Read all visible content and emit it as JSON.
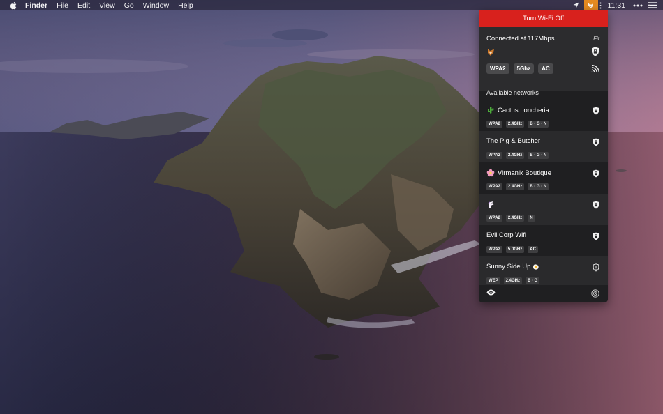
{
  "menubar": {
    "apple_icon": "apple-icon",
    "items": [
      "Finder",
      "File",
      "Edit",
      "View",
      "Go",
      "Window",
      "Help"
    ],
    "clock": "11:31",
    "status_icons": [
      "location-arrow-icon",
      "app-fox-icon",
      "wifi-icon",
      "list-icon"
    ]
  },
  "popover": {
    "toggle_label": "Turn Wi-Fi Off",
    "accent_color": "#d8211d",
    "connected": {
      "title": "Connected at 117Mbps",
      "fit_label": "Fit",
      "network_icon": "fox-icon",
      "chips": [
        "WPA2",
        "5Ghz",
        "AC"
      ]
    },
    "available_title": "Available networks",
    "networks": [
      {
        "name": "Cactus Loncheria",
        "icon": "cactus-icon",
        "secured": true,
        "tags": [
          "WPA2",
          "2.4GHz",
          "B · G · N"
        ]
      },
      {
        "name": "The Pig & Butcher",
        "icon": "",
        "secured": true,
        "tags": [
          "WPA2",
          "2.4GHz",
          "B · G · N"
        ]
      },
      {
        "name": "Virmanik Boutique",
        "icon": "flower-icon",
        "secured": true,
        "tags": [
          "WPA2",
          "2.4GHz",
          "B · G · N"
        ]
      },
      {
        "name": "",
        "icon": "unicorn-icon",
        "secured": true,
        "tags": [
          "WPA2",
          "2.4GHz",
          "N"
        ]
      },
      {
        "name": "Evil Corp Wifi",
        "icon": "",
        "secured": true,
        "tags": [
          "WPA2",
          "5.0GHz",
          "AC"
        ]
      },
      {
        "name": "Sunny Side Up",
        "icon_after": "egg-icon",
        "secured": false,
        "tags": [
          "WEP",
          "2.4GHz",
          "B · G"
        ]
      }
    ],
    "footer_icons": [
      "eye-icon",
      "gear-icon"
    ]
  }
}
